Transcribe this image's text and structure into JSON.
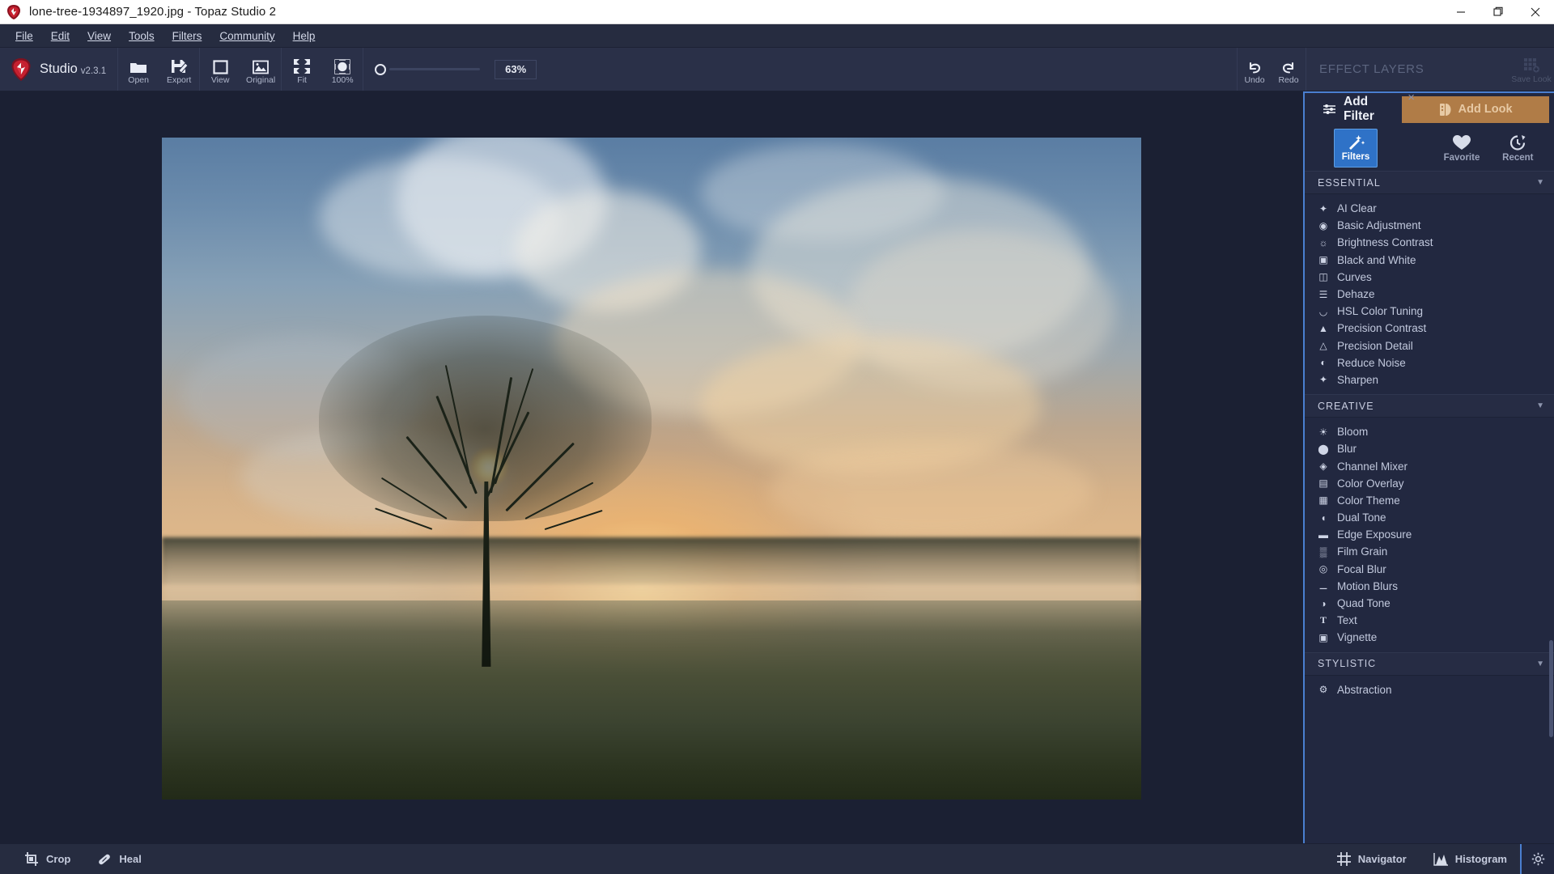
{
  "window": {
    "title": "lone-tree-1934897_1920.jpg - Topaz Studio 2",
    "minimize": "minimize-icon",
    "maximize": "maximize-icon",
    "close": "close-icon"
  },
  "menu": {
    "items": [
      {
        "label": "File"
      },
      {
        "label": "Edit"
      },
      {
        "label": "View"
      },
      {
        "label": "Tools"
      },
      {
        "label": "Filters"
      },
      {
        "label": "Community"
      },
      {
        "label": "Help"
      }
    ]
  },
  "toolbar": {
    "brand_name": "Studio",
    "brand_version": "v2.3.1",
    "buttons": [
      {
        "label": "Open",
        "icon": "folder-icon"
      },
      {
        "label": "Export",
        "icon": "save-export-icon"
      },
      {
        "label": "View",
        "icon": "view-square-icon"
      },
      {
        "label": "Original",
        "icon": "original-image-icon"
      },
      {
        "label": "Fit",
        "icon": "fit-arrows-icon"
      },
      {
        "label": "100%",
        "icon": "zoom-100-icon"
      }
    ],
    "zoom_value": "63%",
    "undo_label": "Undo",
    "redo_label": "Redo",
    "effect_layers_title": "EFFECT LAYERS",
    "save_look_label": "Save Look"
  },
  "right_panel": {
    "close_glyph": "×",
    "add_filter_label": "Add Filter",
    "add_look_label": "Add Look",
    "modes": [
      {
        "label": "Filters",
        "icon": "magic-wand-icon",
        "active": true
      },
      {
        "label": "Favorite",
        "icon": "heart-icon",
        "active": false
      },
      {
        "label": "Recent",
        "icon": "clock-history-icon",
        "active": false
      }
    ],
    "sections": [
      {
        "title": "ESSENTIAL",
        "items": [
          {
            "label": "AI Clear",
            "icon": "sparkle-wand-icon"
          },
          {
            "label": "Basic Adjustment",
            "icon": "aperture-icon"
          },
          {
            "label": "Brightness Contrast",
            "icon": "sun-icon"
          },
          {
            "label": "Black and White",
            "icon": "half-square-icon"
          },
          {
            "label": "Curves",
            "icon": "curve-graph-icon"
          },
          {
            "label": "Dehaze",
            "icon": "haze-icon"
          },
          {
            "label": "HSL Color Tuning",
            "icon": "rainbow-arc-icon"
          },
          {
            "label": "Precision Contrast",
            "icon": "mountain-icon"
          },
          {
            "label": "Precision Detail",
            "icon": "detail-mountain-icon"
          },
          {
            "label": "Reduce Noise",
            "icon": "noise-circle-icon"
          },
          {
            "label": "Sharpen",
            "icon": "sharpen-icon"
          }
        ]
      },
      {
        "title": "CREATIVE",
        "items": [
          {
            "label": "Bloom",
            "icon": "bloom-bulb-icon"
          },
          {
            "label": "Blur",
            "icon": "blur-blob-icon"
          },
          {
            "label": "Channel Mixer",
            "icon": "channel-mixer-icon"
          },
          {
            "label": "Color Overlay",
            "icon": "layers-square-icon"
          },
          {
            "label": "Color Theme",
            "icon": "color-swatch-icon"
          },
          {
            "label": "Dual Tone",
            "icon": "half-circle-icon"
          },
          {
            "label": "Edge Exposure",
            "icon": "rectangle-icon"
          },
          {
            "label": "Film Grain",
            "icon": "grain-dots-icon"
          },
          {
            "label": "Focal Blur",
            "icon": "focus-target-icon"
          },
          {
            "label": "Motion Blurs",
            "icon": "motion-streak-icon"
          },
          {
            "label": "Quad Tone",
            "icon": "quad-circle-icon"
          },
          {
            "label": "Text",
            "icon": "text-t-icon"
          },
          {
            "label": "Vignette",
            "icon": "vignette-icon"
          }
        ]
      },
      {
        "title": "STYLISTIC",
        "items": [
          {
            "label": "Abstraction",
            "icon": "abstraction-gear-icon"
          }
        ]
      }
    ]
  },
  "statusbar": {
    "left": [
      {
        "label": "Crop",
        "icon": "crop-icon"
      },
      {
        "label": "Heal",
        "icon": "bandage-heal-icon"
      }
    ],
    "right": [
      {
        "label": "Navigator",
        "icon": "grid-navigator-icon"
      },
      {
        "label": "Histogram",
        "icon": "histogram-icon"
      }
    ],
    "settings_icon": "gear-icon"
  },
  "colors": {
    "accent_blue": "#2f72c7",
    "panel_border": "#4a7fd0",
    "add_look_bg": "#b07c47",
    "chrome_bg": "#262c40",
    "canvas_bg": "#1b2033"
  }
}
